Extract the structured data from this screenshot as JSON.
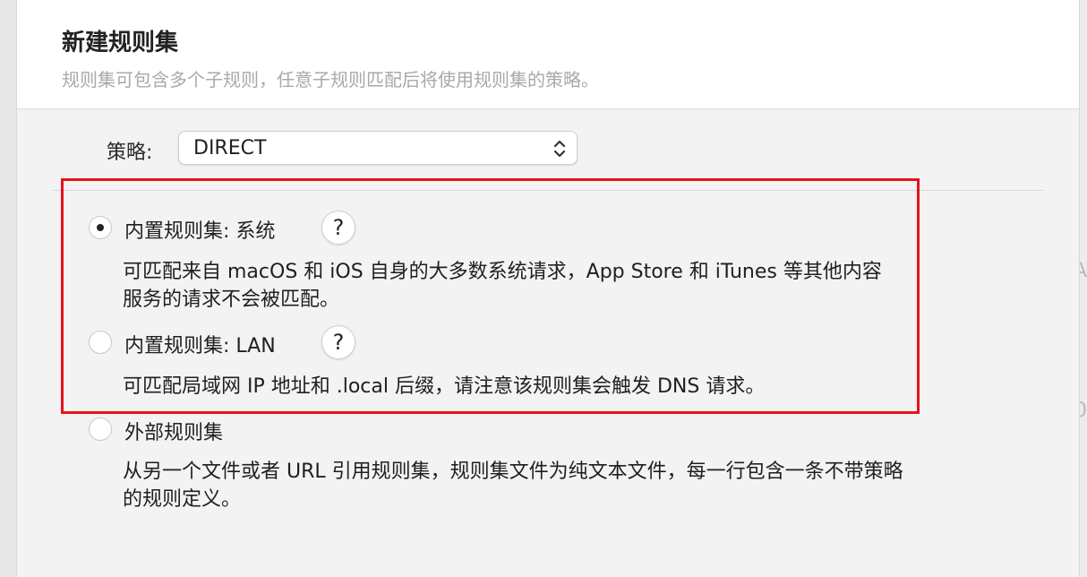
{
  "background": {
    "glyph_upper": "A",
    "glyph_lower": "0"
  },
  "sheet": {
    "title": "新建规则集",
    "subtitle": "规则集可包含多个子规则，任意子规则匹配后将使用规则集的策略。"
  },
  "policy": {
    "label": "策略:",
    "selected": "DIRECT"
  },
  "options": [
    {
      "label": "内置规则集: 系统",
      "help": "?",
      "selected": true,
      "description_line1": "可匹配来自 macOS 和 iOS 自身的大多数系统请求，App Store 和 iTunes 等其他内容",
      "description_line2": "服务的请求不会被匹配。"
    },
    {
      "label": "内置规则集: LAN",
      "help": "?",
      "selected": false,
      "description_line1": "可匹配局域网 IP 地址和 .local 后缀，请注意该规则集会触发 DNS 请求。"
    },
    {
      "label": "外部规则集",
      "selected": false,
      "description_line1": "从另一个文件或者 URL 引用规则集，规则集文件为纯文本文件，每一行包含一条不带策略",
      "description_line2": "的规则定义。"
    }
  ],
  "colors": {
    "highlight": "#e3141b",
    "sheet_background": "#f3f3f3",
    "header_background": "#ffffff"
  }
}
